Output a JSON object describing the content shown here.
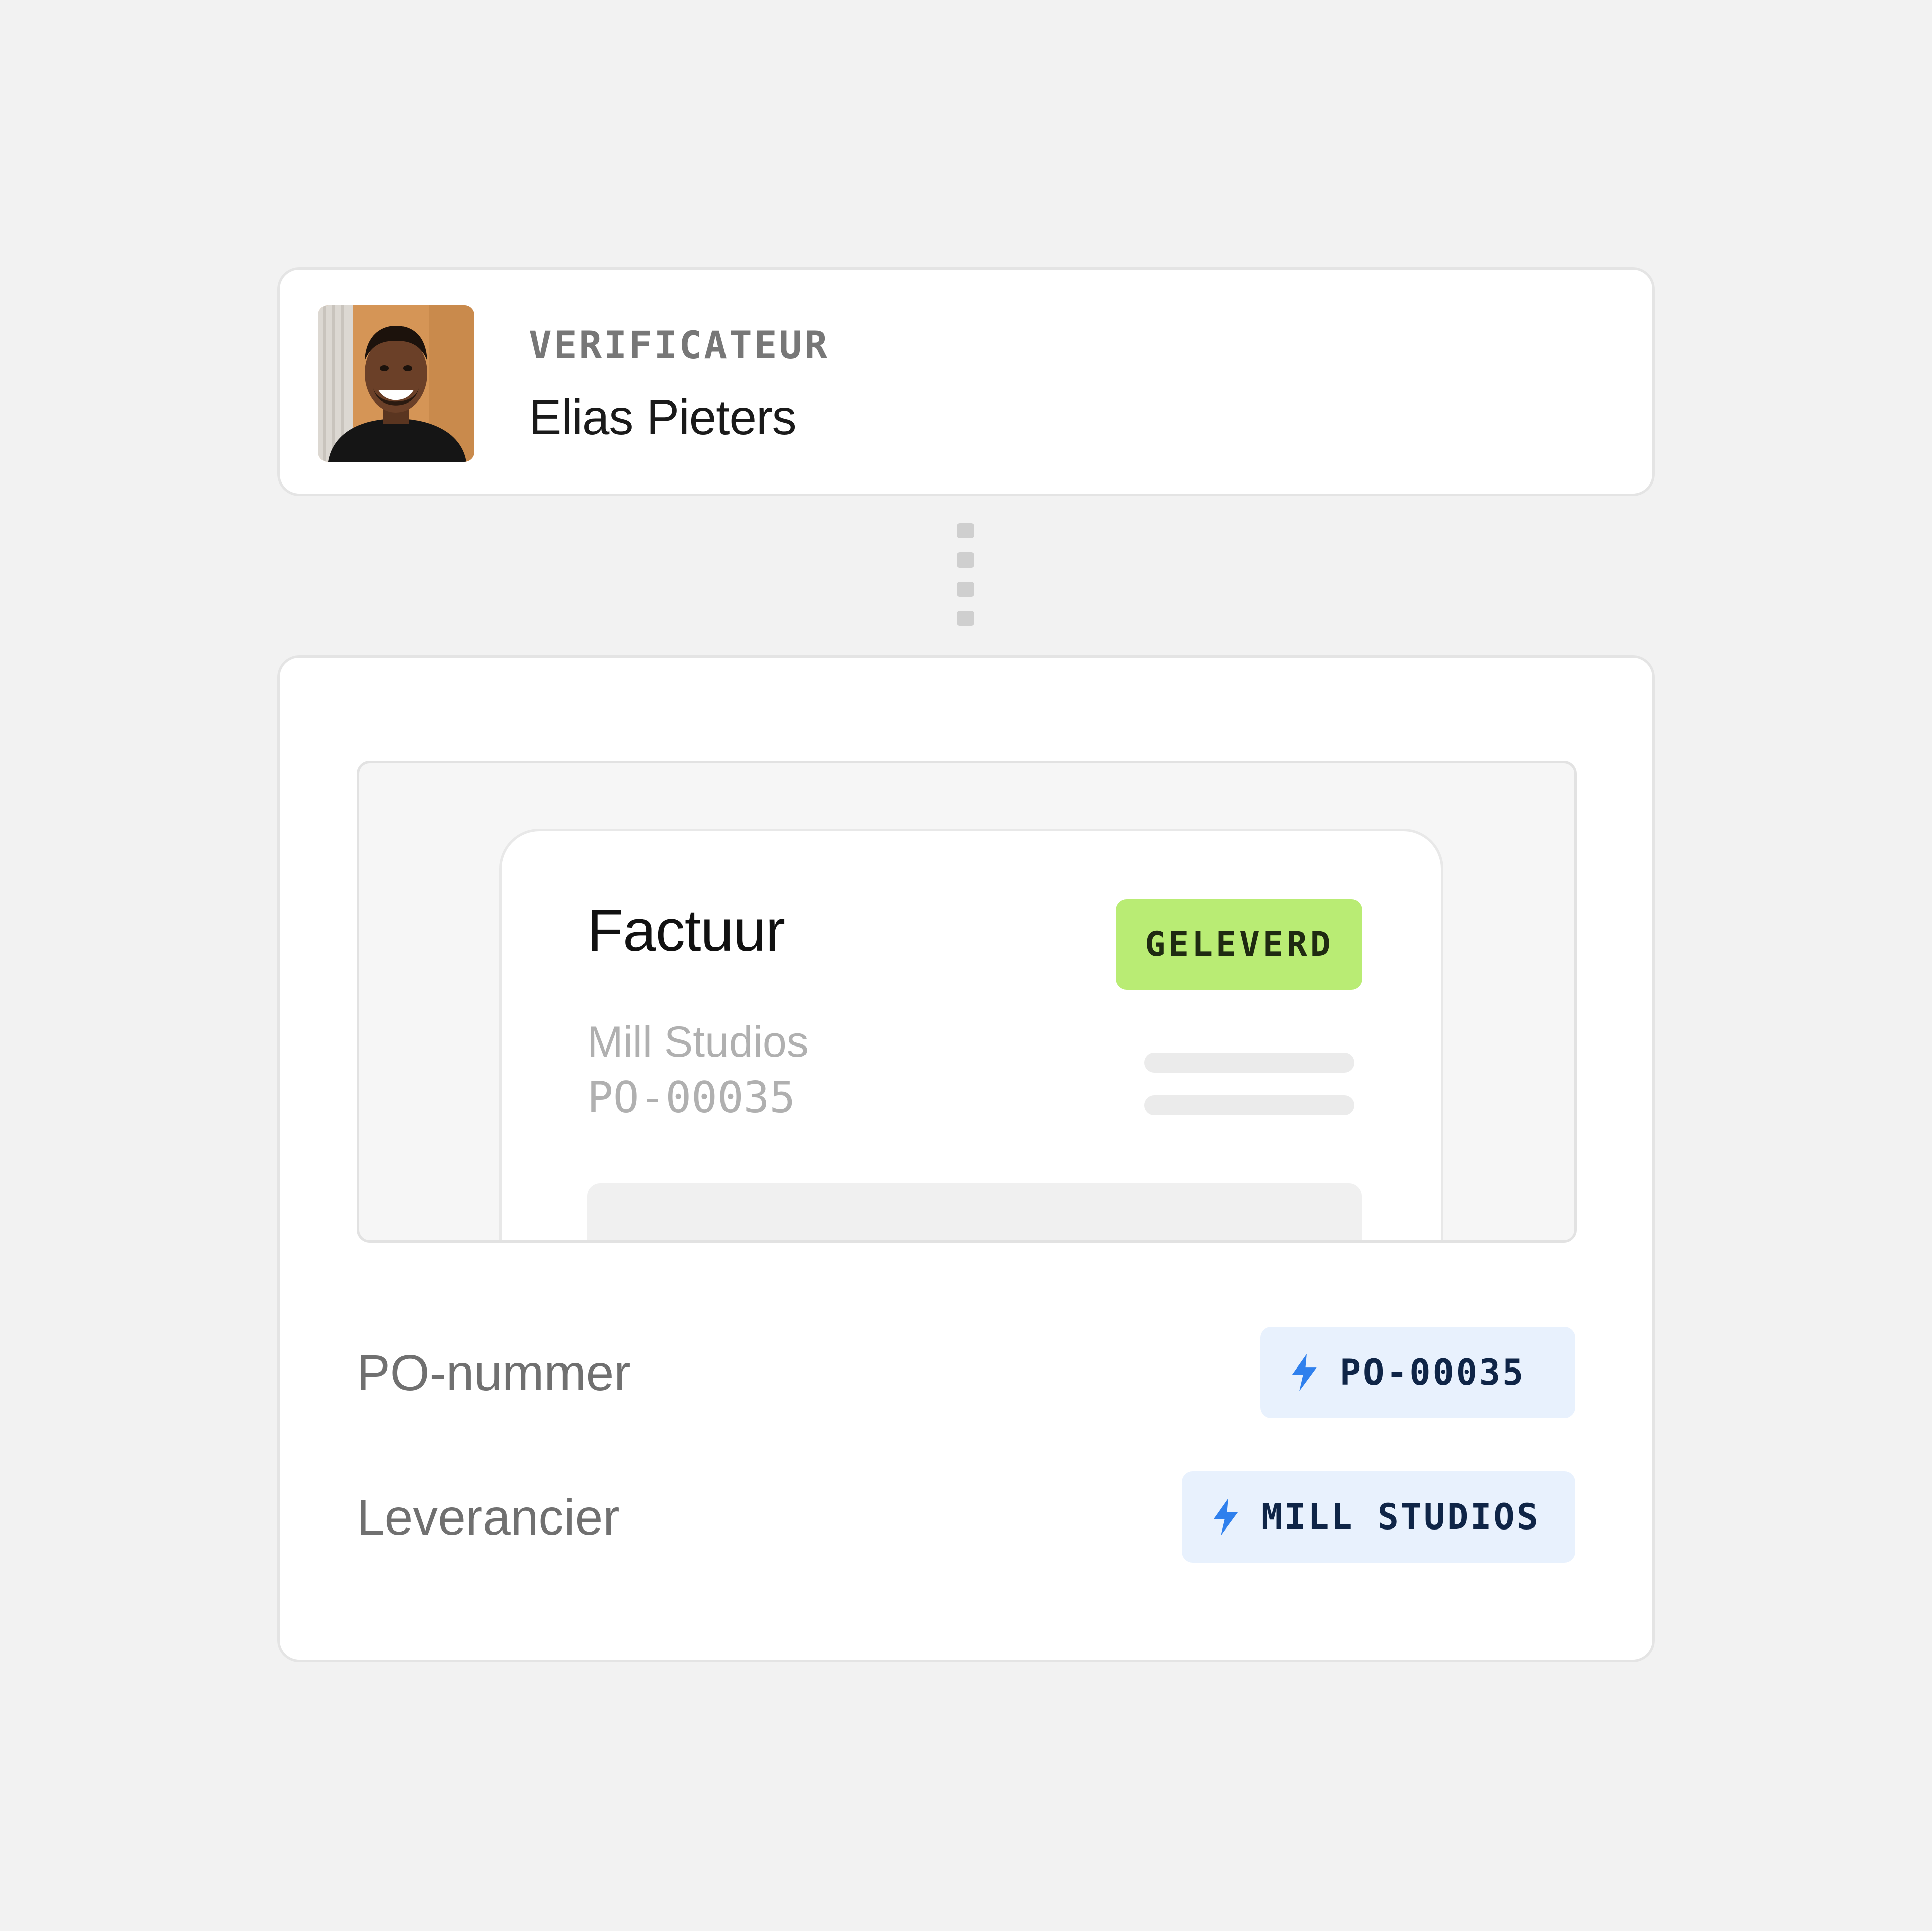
{
  "verifier": {
    "role": "VERIFICATEUR",
    "name": "Elias Pieters",
    "avatar_icon": "person-photo"
  },
  "connector": {
    "icon": "dotted-vertical-connector"
  },
  "invoice_preview": {
    "title": "Factuur",
    "status": "GELEVERD",
    "status_color": "#b9ec74",
    "vendor": "Mill Studios",
    "po_number": "PO-00035"
  },
  "fields": [
    {
      "label": "PO-nummer",
      "value": "PO-00035",
      "icon": "lightning-bolt-icon"
    },
    {
      "label": "Leverancier",
      "value": "MILL STUDIOS",
      "icon": "lightning-bolt-icon"
    }
  ],
  "colors": {
    "background": "#f2f2f2",
    "chip_background": "#e8f1fd",
    "bolt": "#2f80ed",
    "chip_text": "#0f2547"
  }
}
